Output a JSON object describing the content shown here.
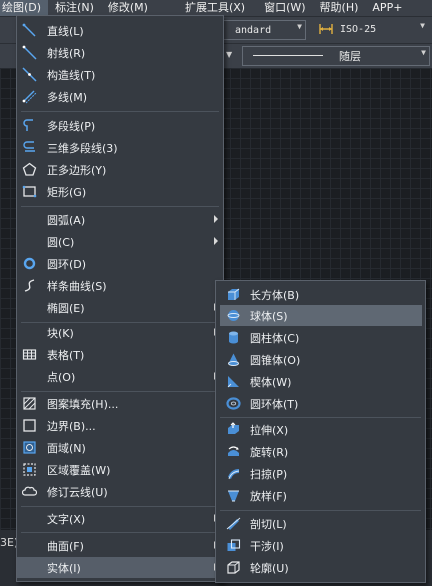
{
  "menubar": {
    "items": [
      "绘图(D)",
      "标注(N)",
      "修改(M)",
      "扩展工具(X)",
      "窗口(W)",
      "帮助(H)",
      "APP+"
    ]
  },
  "toolbar": {
    "text_style": "andard",
    "dim_style": "ISO-25",
    "layer_label": "随层"
  },
  "cmdline": {
    "text": "3E)"
  },
  "draw_menu": {
    "items": [
      {
        "label": "直线(L)",
        "icon": "line-icon"
      },
      {
        "label": "射线(R)",
        "icon": "ray-icon"
      },
      {
        "label": "构造线(T)",
        "icon": "xline-icon"
      },
      {
        "label": "多线(M)",
        "icon": "mline-icon"
      },
      {
        "label": "多段线(P)",
        "icon": "polyline-icon"
      },
      {
        "label": "三维多段线(3)",
        "icon": "3d-polyline-icon"
      },
      {
        "label": "正多边形(Y)",
        "icon": "polygon-icon"
      },
      {
        "label": "矩形(G)",
        "icon": "rectangle-icon"
      },
      {
        "label": "圆弧(A)",
        "icon": "",
        "submenu": true
      },
      {
        "label": "圆(C)",
        "icon": "",
        "submenu": true
      },
      {
        "label": "圆环(D)",
        "icon": "donut-icon"
      },
      {
        "label": "样条曲线(S)",
        "icon": "spline-icon"
      },
      {
        "label": "椭圆(E)",
        "icon": "",
        "submenu": true
      },
      {
        "label": "块(K)",
        "icon": "",
        "submenu": true
      },
      {
        "label": "表格(T)",
        "icon": "table-icon"
      },
      {
        "label": "点(O)",
        "icon": "",
        "submenu": true
      },
      {
        "label": "图案填充(H)...",
        "icon": "hatch-icon"
      },
      {
        "label": "边界(B)...",
        "icon": "boundary-icon"
      },
      {
        "label": "面域(N)",
        "icon": "region-icon"
      },
      {
        "label": "区域覆盖(W)",
        "icon": "wipeout-icon"
      },
      {
        "label": "修订云线(U)",
        "icon": "revcloud-icon"
      },
      {
        "label": "文字(X)",
        "icon": "",
        "submenu": true
      },
      {
        "label": "曲面(F)",
        "icon": "",
        "submenu": true
      },
      {
        "label": "实体(I)",
        "icon": "",
        "submenu": true
      }
    ]
  },
  "solid_menu": {
    "items": [
      {
        "label": "长方体(B)",
        "icon": "box-icon"
      },
      {
        "label": "球体(S)",
        "icon": "sphere-icon"
      },
      {
        "label": "圆柱体(C)",
        "icon": "cylinder-icon"
      },
      {
        "label": "圆锥体(O)",
        "icon": "cone-icon"
      },
      {
        "label": "楔体(W)",
        "icon": "wedge-icon"
      },
      {
        "label": "圆环体(T)",
        "icon": "torus-icon"
      },
      {
        "label": "拉伸(X)",
        "icon": "extrude-icon"
      },
      {
        "label": "旋转(R)",
        "icon": "revolve-icon"
      },
      {
        "label": "扫掠(P)",
        "icon": "sweep-icon"
      },
      {
        "label": "放样(F)",
        "icon": "loft-icon"
      },
      {
        "label": "剖切(L)",
        "icon": "slice-icon"
      },
      {
        "label": "干涉(I)",
        "icon": "interfere-icon"
      },
      {
        "label": "轮廓(U)",
        "icon": "profile-icon"
      }
    ]
  },
  "colors": {
    "accent_blue": "#59a6f0",
    "menu_bg": "#353a41",
    "highlight": "#5f6873"
  }
}
